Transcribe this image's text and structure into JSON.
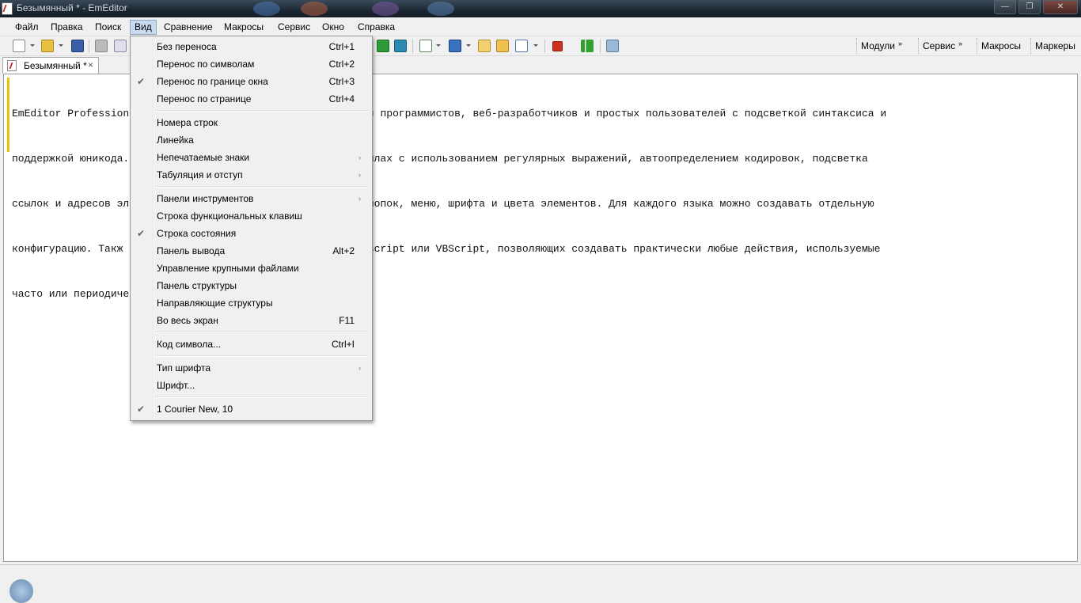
{
  "window": {
    "title": "Безымянный * - EmEditor",
    "buttons": {
      "minimize": "—",
      "maximize": "❐",
      "close": "✕"
    }
  },
  "menubar": {
    "items": [
      "Файл",
      "Правка",
      "Поиск",
      "Вид",
      "Сравнение",
      "Макросы",
      "Сервис",
      "Окно",
      "Справка"
    ],
    "active": "Вид"
  },
  "toolbar": {
    "right_items": [
      "Модули",
      "Сервис",
      "Макросы",
      "Маркеры"
    ]
  },
  "tab": {
    "label": "Безымянный *",
    "close": "×"
  },
  "editor": {
    "visible_lines": [
      "EmEditor Profession",
      "поддержкой юникода.",
      "ссылок и адресов эл",
      "конфигурацию. Такж",
      "часто или периодиче"
    ],
    "right_lines": [
      "екстового редактора для программистов, веб-разработчиков и простых пользователей с подсветкой синтаксиса и",
      "ак поиск и замена в файлах с использованием регулярных выражений, автоопределением кодировок, подсветка",
      "ия, настройка панели кнопок, меню, шрифта и цвета элементов. Для каждого языка можно создавать отдельную",
      "осов написанных на javascript или VBScript, позволяющих создавать практически любые действия, используемые",
      ""
    ]
  },
  "view_menu": {
    "items": [
      {
        "label": "Без переноса",
        "shortcut": "Ctrl+1",
        "checked": false,
        "submenu": false
      },
      {
        "label": "Перенос по символам",
        "shortcut": "Ctrl+2",
        "checked": false,
        "submenu": false
      },
      {
        "label": "Перенос по границе окна",
        "shortcut": "Ctrl+3",
        "checked": true,
        "submenu": false
      },
      {
        "label": "Перенос по странице",
        "shortcut": "Ctrl+4",
        "checked": false,
        "submenu": false
      },
      {
        "separator": true
      },
      {
        "label": "Номера строк",
        "shortcut": "",
        "checked": false,
        "submenu": false
      },
      {
        "label": "Линейка",
        "shortcut": "",
        "checked": false,
        "submenu": false
      },
      {
        "label": "Непечатаемые знаки",
        "shortcut": "",
        "checked": false,
        "submenu": true
      },
      {
        "label": "Табуляция и отступ",
        "shortcut": "",
        "checked": false,
        "submenu": true
      },
      {
        "separator": true
      },
      {
        "label": "Панели инструментов",
        "shortcut": "",
        "checked": false,
        "submenu": true
      },
      {
        "label": "Строка функциональных клавиш",
        "shortcut": "",
        "checked": false,
        "submenu": false
      },
      {
        "label": "Строка состояния",
        "shortcut": "",
        "checked": true,
        "submenu": false
      },
      {
        "label": "Панель вывода",
        "shortcut": "Alt+2",
        "checked": false,
        "submenu": false
      },
      {
        "label": "Управление крупными файлами",
        "shortcut": "",
        "checked": false,
        "submenu": false
      },
      {
        "label": "Панель структуры",
        "shortcut": "",
        "checked": false,
        "submenu": false
      },
      {
        "label": "Направляющие структуры",
        "shortcut": "",
        "checked": false,
        "submenu": false
      },
      {
        "label": "Во весь экран",
        "shortcut": "F11",
        "checked": false,
        "submenu": false
      },
      {
        "separator": true
      },
      {
        "label": "Код символа...",
        "shortcut": "Ctrl+I",
        "checked": false,
        "submenu": false
      },
      {
        "separator": true
      },
      {
        "label": "Тип шрифта",
        "shortcut": "",
        "checked": false,
        "submenu": true
      },
      {
        "label": "Шрифт...",
        "shortcut": "",
        "checked": false,
        "submenu": false
      },
      {
        "separator": true
      },
      {
        "label": "1 Courier New, 10",
        "shortcut": "",
        "checked": true,
        "submenu": false
      }
    ]
  },
  "icons": {
    "check": "✔",
    "submenu_arrow": "›",
    "chevron": "»"
  }
}
